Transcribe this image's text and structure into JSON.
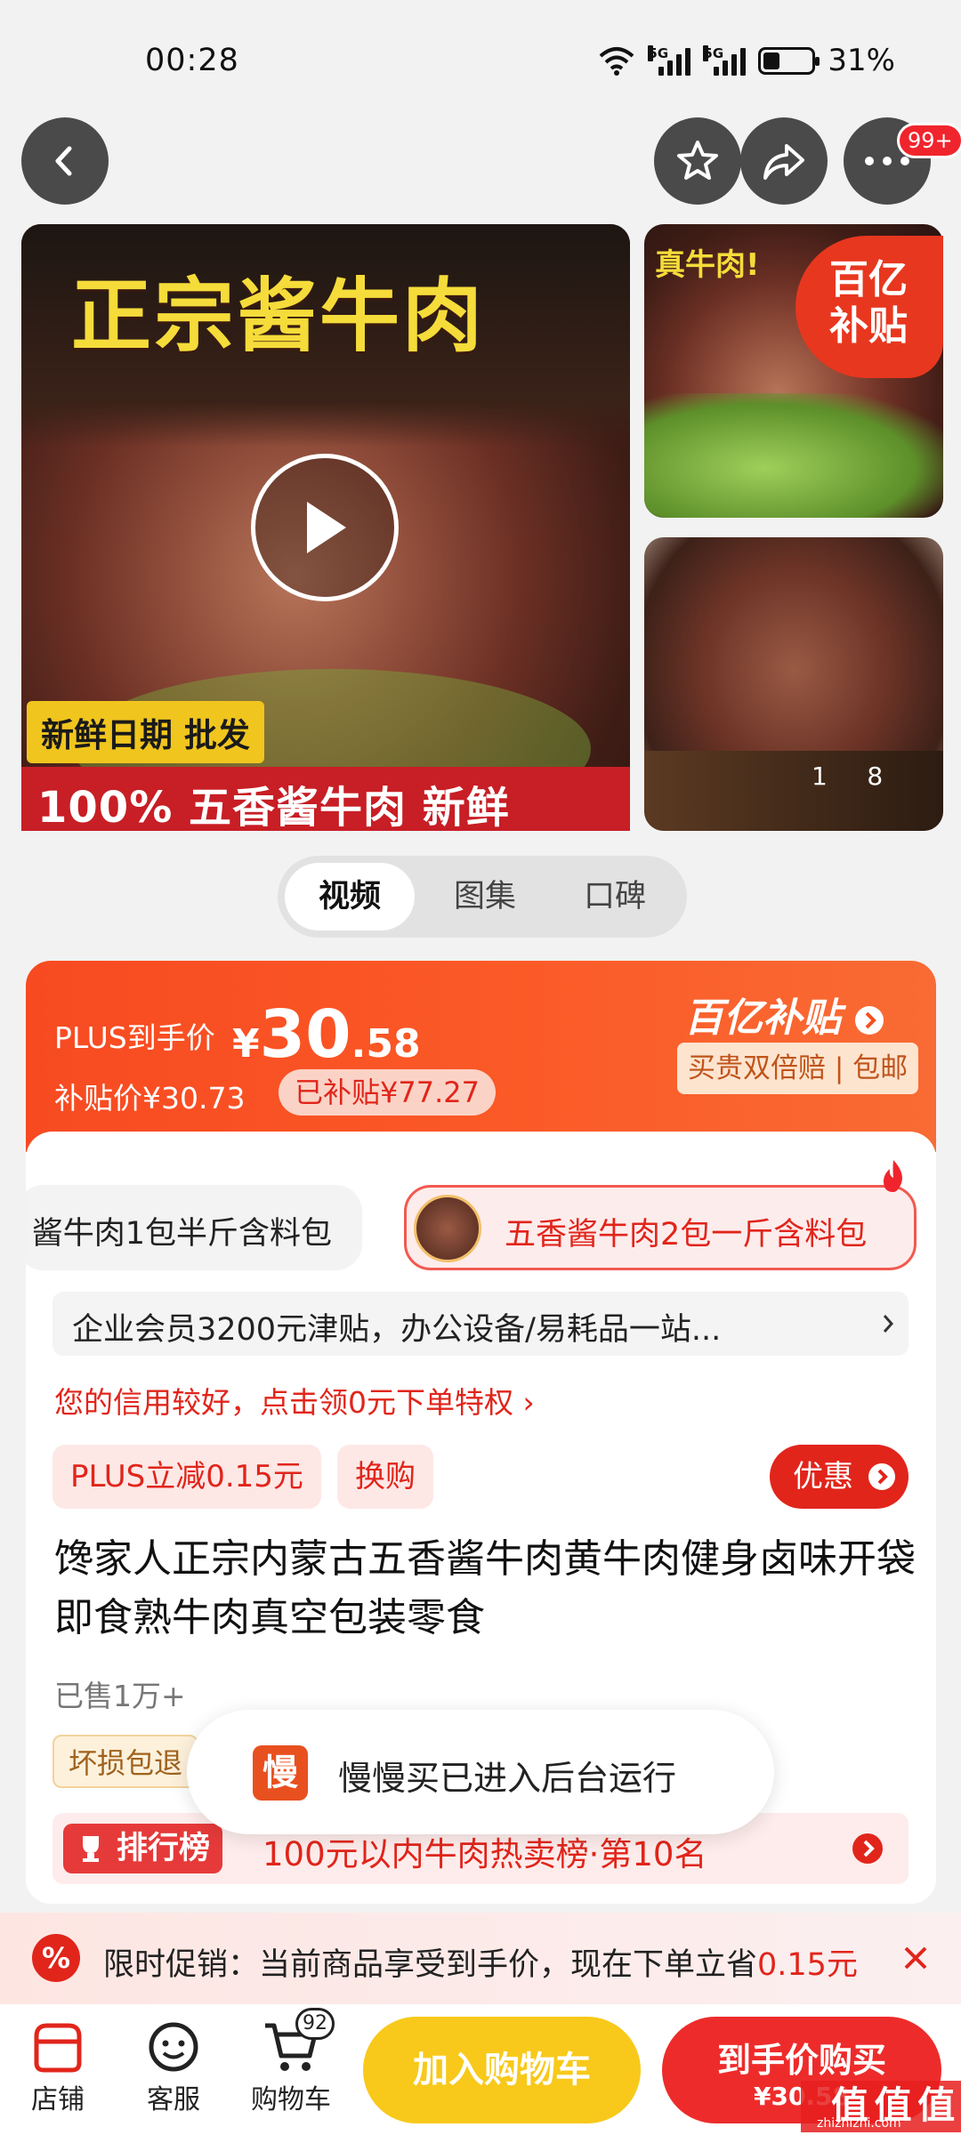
{
  "status_bar": {
    "time": "00:28",
    "network_1": "5G",
    "network_2": "5G",
    "battery_percent": "31%",
    "battery_level": 0.31
  },
  "header": {
    "more_badge": "99+"
  },
  "gallery": {
    "main_title": "正宗酱牛肉",
    "tag_fresh": "新鲜日期 批发",
    "bottom_band": "100% 五香酱牛肉 新鲜",
    "side_caption": "真牛肉!",
    "subsidy_badge_line1": "百亿",
    "subsidy_badge_line2": "补贴",
    "counter_current": "1",
    "counter_total": "8"
  },
  "media_tabs": [
    {
      "label": "视频",
      "active": true
    },
    {
      "label": "图集",
      "active": false
    },
    {
      "label": "口碑",
      "active": false
    }
  ],
  "price": {
    "plus_label": "PLUS到手价",
    "currency": "¥",
    "integer": "30",
    "decimal": ".58",
    "subsidy_price": "补贴价¥30.73",
    "subsidized": "已补贴¥77.27",
    "brand": "百亿补贴",
    "guarantee": "买贵双倍赔 | 包邮"
  },
  "variants": [
    {
      "label": "酱牛肉1包半斤含料包",
      "selected": false
    },
    {
      "label": "五香酱牛肉2包一斤含料包",
      "selected": true
    }
  ],
  "enterprise_banner": "企业会员3200元津贴，办公设备/易耗品一站...",
  "credit_line": "您的信用较好，点击领0元下单特权",
  "promo_tags": {
    "plus_discount": "PLUS立减0.15元",
    "exchange": "换购",
    "coupon_button": "优惠"
  },
  "product": {
    "title": "馋家人正宗内蒙古五香酱牛肉黄牛肉健身卤味开袋即食熟牛肉真空包装零食",
    "sold": "已售1万+",
    "service_tag": "坏损包退"
  },
  "ranking": {
    "badge": "排行榜",
    "text": "100元以内牛肉热卖榜·第10名"
  },
  "toast": {
    "icon_char": "慢",
    "text": "慢慢买已进入后台运行"
  },
  "promo_banner": {
    "text": "限时促销：当前商品享受到手价，现在下单立省",
    "amount": "0.15元"
  },
  "bottom_nav": {
    "store": "店铺",
    "service": "客服",
    "cart": "购物车",
    "cart_count": "92",
    "add_to_cart": "加入购物车",
    "buy_now": "到手价购买",
    "buy_price": "¥30.58"
  },
  "watermark": {
    "text": "值 值 值",
    "url": "zhizhizhi.com"
  }
}
